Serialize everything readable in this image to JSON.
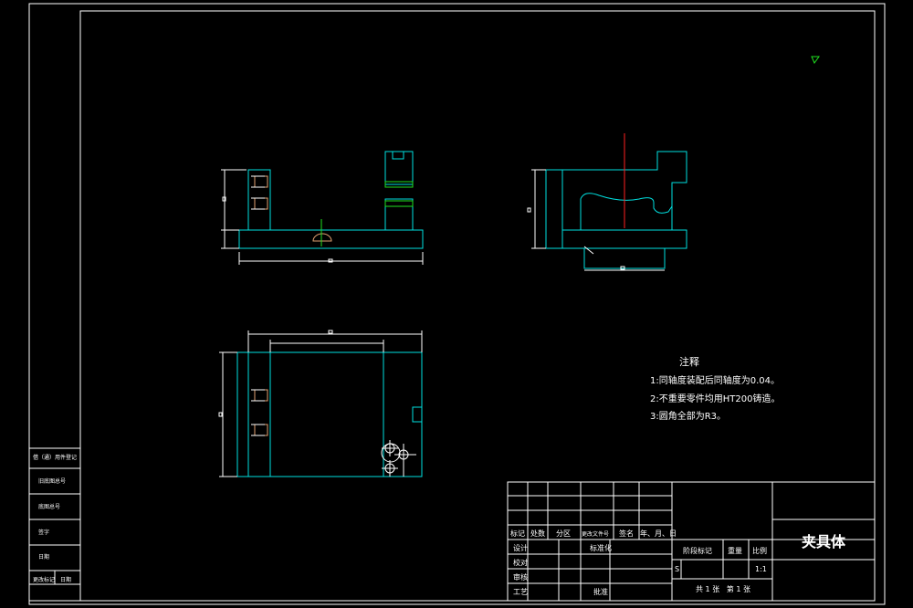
{
  "drawing": {
    "title": "夹具体",
    "sheet_info": "共 1 张   第 1 张",
    "scale_value": "1:1",
    "stage_mark": "S"
  },
  "notes": {
    "heading": "注释",
    "items": [
      "1:同轴度装配后同轴度为0.04。",
      "2:不重要零件均用HT200铸造。",
      "3:圆角全部为R3。"
    ]
  },
  "left_strip": {
    "labels": [
      "借（通）用件登记",
      "旧底图总号",
      "底图总号",
      "签字",
      "日期",
      "更改标记",
      "日期"
    ]
  },
  "title_block": {
    "change_row": [
      "标记",
      "处数",
      "分区",
      "更改文件号",
      "签名",
      "年、月、日"
    ],
    "design_row": [
      "设计",
      "标准化"
    ],
    "check_row": [
      "校对"
    ],
    "review_row": [
      "审核"
    ],
    "process_row": [
      "工艺",
      "批准"
    ],
    "stage_headers": [
      "阶段标记",
      "重量",
      "比例"
    ]
  }
}
